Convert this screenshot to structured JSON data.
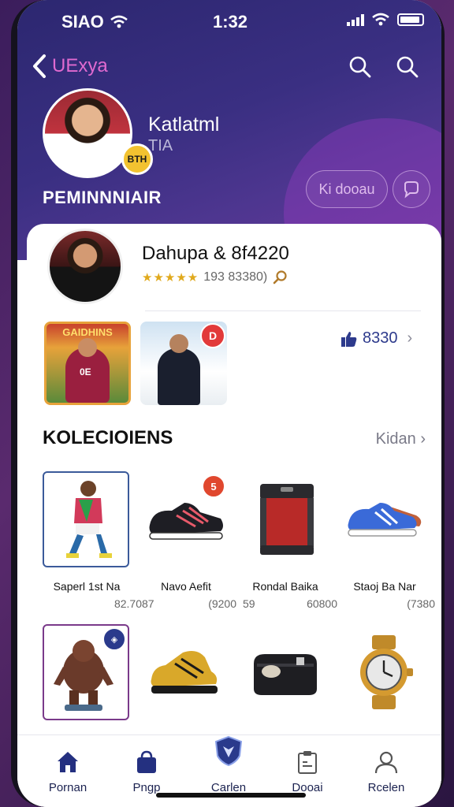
{
  "status": {
    "carrier": "SIAO",
    "time": "1:32"
  },
  "nav": {
    "back_title": "UExya"
  },
  "profile": {
    "name": "Katlatml",
    "subtitle": "TIA",
    "badge_text": "BTH",
    "tier": "PEMINNNIAIR",
    "follow_label": "Ki dooau"
  },
  "player": {
    "name": "Dahupa & 8f4220",
    "stars": "★★★★★",
    "rating_text": "193 83380)"
  },
  "featured": {
    "card1_title": "GAIDHINS",
    "card1_number": "0E",
    "card2_badge": "D",
    "likes": "8330"
  },
  "collection": {
    "title": "KOLECIOIENS",
    "see_all": "Kidan ›",
    "items": [
      {
        "name": "Saperl 1st Na",
        "left": "",
        "right": "82.70",
        "icon": "player-figure"
      },
      {
        "name": "Navo Aefit",
        "left": "87",
        "right": "(9200",
        "icon": "sneaker-black",
        "badge": "5"
      },
      {
        "name": "Rondal Baika",
        "left": "59",
        "right": "60800",
        "icon": "red-case"
      },
      {
        "name": "Staoj Ba Nar",
        "left": "",
        "right": "(7380",
        "icon": "sneaker-blue"
      },
      {
        "name": "",
        "icon": "creature-figure"
      },
      {
        "name": "",
        "icon": "gold-sneaker"
      },
      {
        "name": "",
        "icon": "black-case"
      },
      {
        "name": "",
        "icon": "gold-watch"
      }
    ]
  },
  "tabs": [
    {
      "label": "Pornan",
      "icon": "home-icon"
    },
    {
      "label": "Pngp",
      "icon": "bag-icon"
    },
    {
      "label": "Carlen",
      "icon": "shield-icon"
    },
    {
      "label": "Dooai",
      "icon": "clipboard-icon"
    },
    {
      "label": "Rcelen",
      "icon": "user-icon"
    }
  ]
}
